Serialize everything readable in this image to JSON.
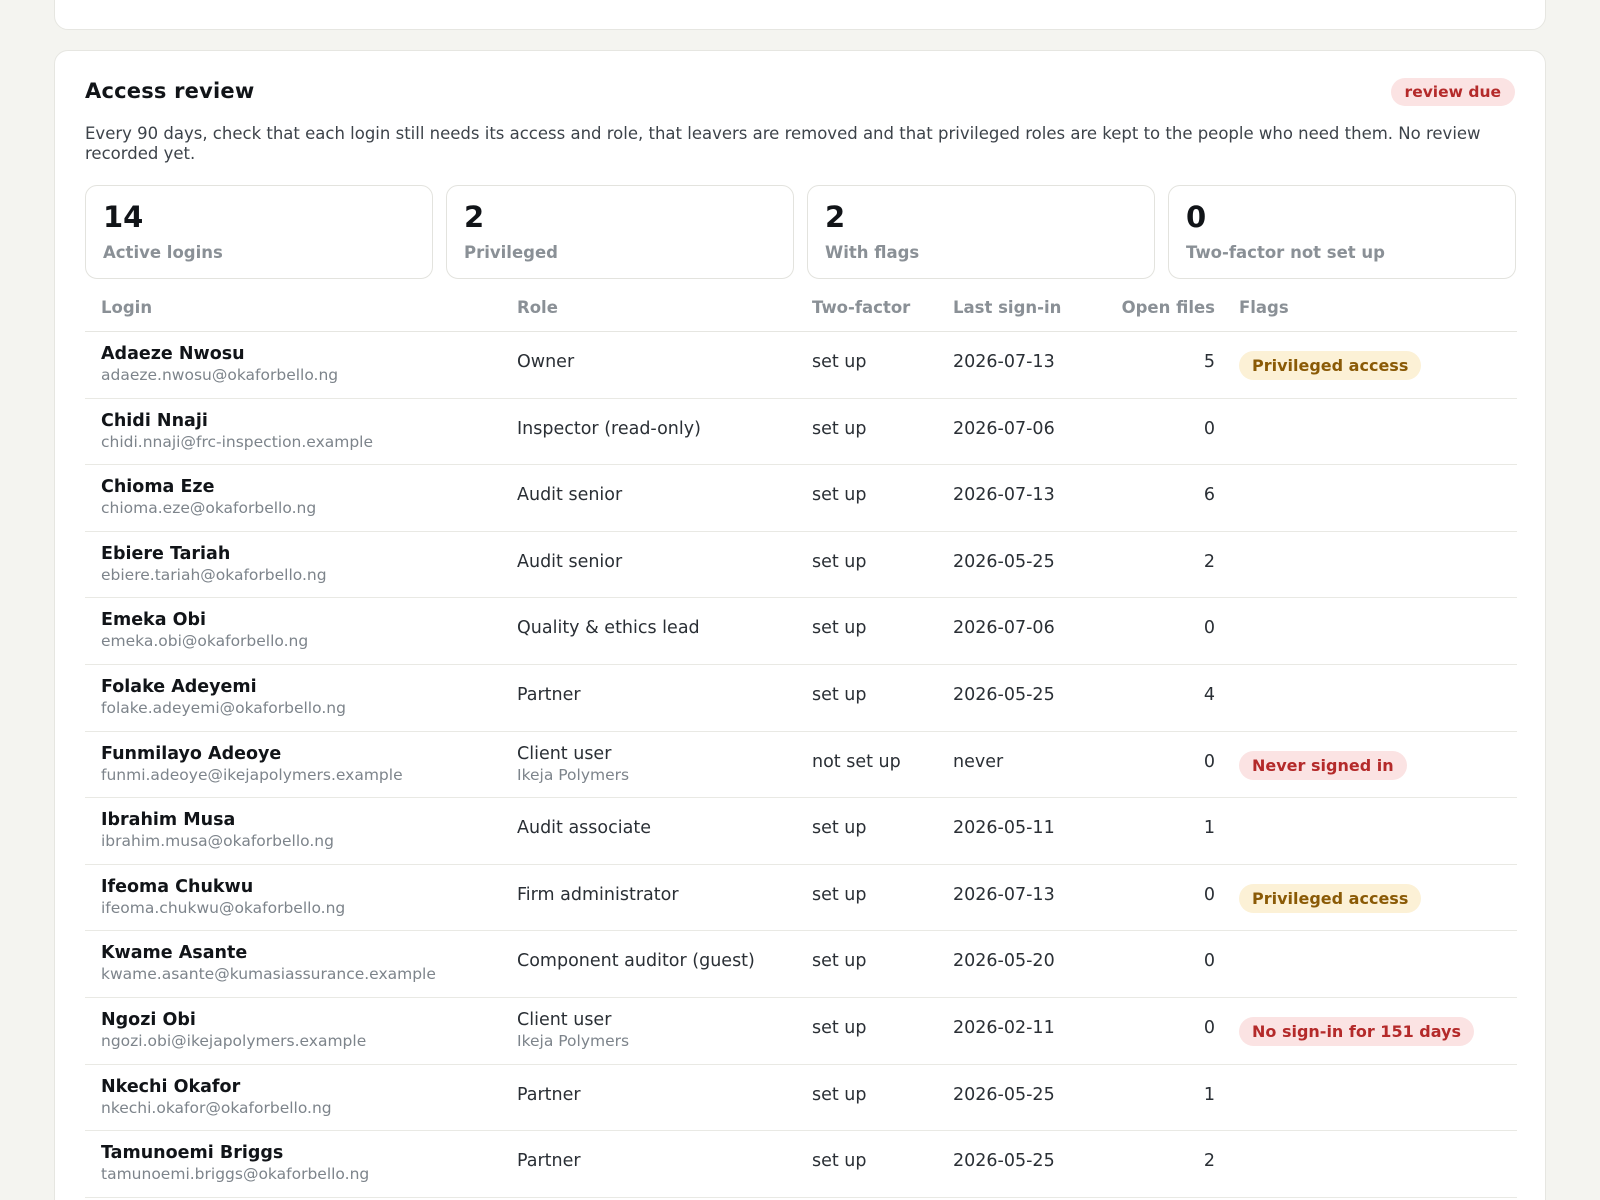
{
  "card": {
    "title": "Access review",
    "status_badge": "review due",
    "description": "Every 90 days, check that each login still needs its access and role, that leavers are removed and that privileged roles are kept to the people who need them. No review recorded yet."
  },
  "stats": [
    {
      "value": "14",
      "label": "Active logins"
    },
    {
      "value": "2",
      "label": "Privileged"
    },
    {
      "value": "2",
      "label": "With flags"
    },
    {
      "value": "0",
      "label": "Two-factor not set up"
    }
  ],
  "table": {
    "headers": {
      "login": "Login",
      "role": "Role",
      "two_factor": "Two-factor",
      "last_sign_in": "Last sign-in",
      "open_files": "Open files",
      "flags": "Flags"
    },
    "rows": [
      {
        "name": "Adaeze Nwosu",
        "email": "adaeze.nwosu@okaforbello.ng",
        "role": "Owner",
        "subrole": "",
        "two_factor": "set up",
        "last_sign_in": "2026-07-13",
        "open_files": "5",
        "flag": "Privileged access",
        "flag_tone": "amber"
      },
      {
        "name": "Chidi Nnaji",
        "email": "chidi.nnaji@frc-inspection.example",
        "role": "Inspector (read-only)",
        "subrole": "",
        "two_factor": "set up",
        "last_sign_in": "2026-07-06",
        "open_files": "0",
        "flag": "",
        "flag_tone": ""
      },
      {
        "name": "Chioma Eze",
        "email": "chioma.eze@okaforbello.ng",
        "role": "Audit senior",
        "subrole": "",
        "two_factor": "set up",
        "last_sign_in": "2026-07-13",
        "open_files": "6",
        "flag": "",
        "flag_tone": ""
      },
      {
        "name": "Ebiere Tariah",
        "email": "ebiere.tariah@okaforbello.ng",
        "role": "Audit senior",
        "subrole": "",
        "two_factor": "set up",
        "last_sign_in": "2026-05-25",
        "open_files": "2",
        "flag": "",
        "flag_tone": ""
      },
      {
        "name": "Emeka Obi",
        "email": "emeka.obi@okaforbello.ng",
        "role": "Quality & ethics lead",
        "subrole": "",
        "two_factor": "set up",
        "last_sign_in": "2026-07-06",
        "open_files": "0",
        "flag": "",
        "flag_tone": ""
      },
      {
        "name": "Folake Adeyemi",
        "email": "folake.adeyemi@okaforbello.ng",
        "role": "Partner",
        "subrole": "",
        "two_factor": "set up",
        "last_sign_in": "2026-05-25",
        "open_files": "4",
        "flag": "",
        "flag_tone": ""
      },
      {
        "name": "Funmilayo Adeoye",
        "email": "funmi.adeoye@ikejapolymers.example",
        "role": "Client user",
        "subrole": "Ikeja Polymers",
        "two_factor": "not set up",
        "last_sign_in": "never",
        "open_files": "0",
        "flag": "Never signed in",
        "flag_tone": "red"
      },
      {
        "name": "Ibrahim Musa",
        "email": "ibrahim.musa@okaforbello.ng",
        "role": "Audit associate",
        "subrole": "",
        "two_factor": "set up",
        "last_sign_in": "2026-05-11",
        "open_files": "1",
        "flag": "",
        "flag_tone": ""
      },
      {
        "name": "Ifeoma Chukwu",
        "email": "ifeoma.chukwu@okaforbello.ng",
        "role": "Firm administrator",
        "subrole": "",
        "two_factor": "set up",
        "last_sign_in": "2026-07-13",
        "open_files": "0",
        "flag": "Privileged access",
        "flag_tone": "amber"
      },
      {
        "name": "Kwame Asante",
        "email": "kwame.asante@kumasiassurance.example",
        "role": "Component auditor (guest)",
        "subrole": "",
        "two_factor": "set up",
        "last_sign_in": "2026-05-20",
        "open_files": "0",
        "flag": "",
        "flag_tone": ""
      },
      {
        "name": "Ngozi Obi",
        "email": "ngozi.obi@ikejapolymers.example",
        "role": "Client user",
        "subrole": "Ikeja Polymers",
        "two_factor": "set up",
        "last_sign_in": "2026-02-11",
        "open_files": "0",
        "flag": "No sign-in for 151 days",
        "flag_tone": "red"
      },
      {
        "name": "Nkechi Okafor",
        "email": "nkechi.okafor@okaforbello.ng",
        "role": "Partner",
        "subrole": "",
        "two_factor": "set up",
        "last_sign_in": "2026-05-25",
        "open_files": "1",
        "flag": "",
        "flag_tone": ""
      },
      {
        "name": "Tamunoemi Briggs",
        "email": "tamunoemi.briggs@okaforbello.ng",
        "role": "Partner",
        "subrole": "",
        "two_factor": "set up",
        "last_sign_in": "2026-05-25",
        "open_files": "2",
        "flag": "",
        "flag_tone": ""
      }
    ]
  }
}
